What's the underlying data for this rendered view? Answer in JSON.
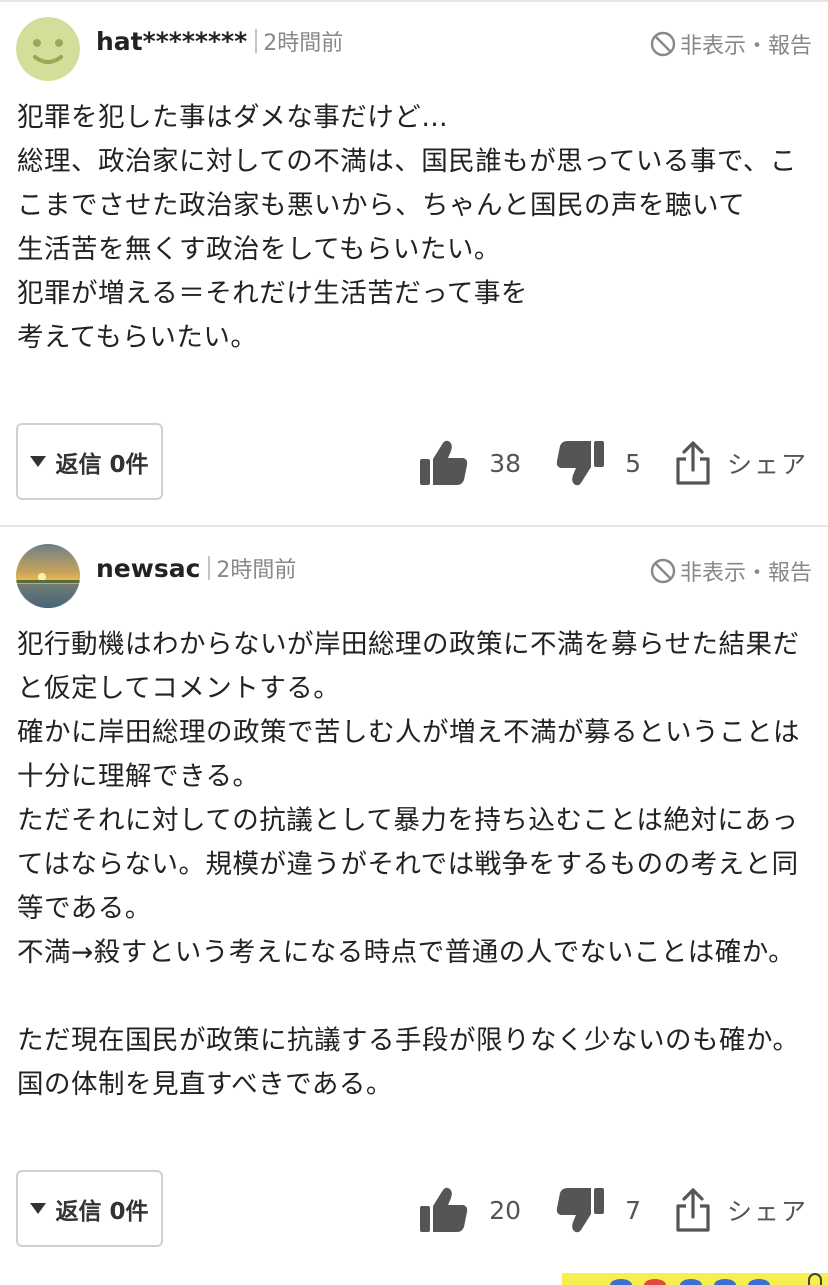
{
  "comments": [
    {
      "username": "hat********",
      "time": "2時間前",
      "hide_report": "非表示・報告",
      "body": "犯罪を犯した事はダメな事だけど…\n総理、政治家に対しての不満は、国民誰もが思っている事で、ここまでさせた政治家も悪いから、ちゃんと国民の声を聴いて\n生活苦を無くす政治をしてもらいたい。\n犯罪が増える＝それだけ生活苦だって事を\n考えてもらいたい。",
      "reply_label": "返信 0件",
      "likes": "38",
      "dislikes": "5",
      "share_label": "シェア",
      "avatar_icon": "smiley-face-icon",
      "avatar_color": "#d4dd9a"
    },
    {
      "username": "newsac",
      "time": "2時間前",
      "hide_report": "非表示・報告",
      "body": "犯行動機はわからないが岸田総理の政策に不満を募らせた結果だと仮定してコメントする。\n確かに岸田総理の政策で苦しむ人が増え不満が募るということは十分に理解できる。\nただそれに対しての抗議として暴力を持ち込むことは絶対にあってはならない。規模が違うがそれでは戦争をするものの考えと同等である。\n不満→殺すという考えになる時点で普通の人でないことは確か。\n\nただ現在国民が政策に抗議する手段が限りなく少ないのも確か。国の体制を見直すべきである。",
      "reply_label": "返信 0件",
      "likes": "20",
      "dislikes": "7",
      "share_label": "シェア",
      "avatar_icon": "sunset-photo-icon"
    }
  ],
  "colors": {
    "text": "#222222",
    "muted": "#888888",
    "icon": "#555555",
    "divider": "#e6e6e6"
  }
}
